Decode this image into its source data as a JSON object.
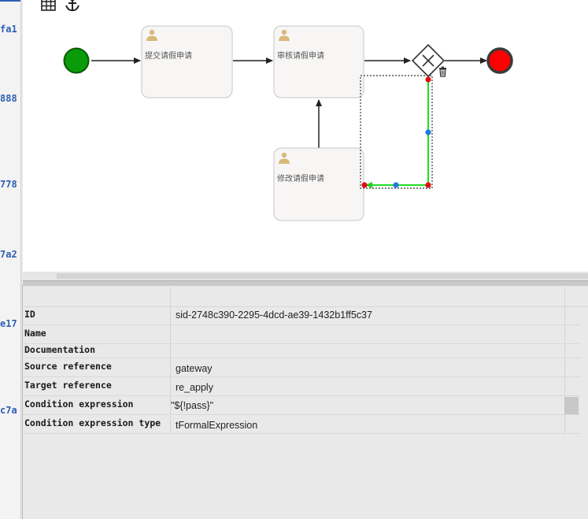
{
  "gutter": {
    "items": [
      "fa1",
      "888",
      "778",
      "7a2",
      "e17",
      "c7a"
    ]
  },
  "toolbar": {
    "icons": [
      "grid-icon",
      "anchor-icon"
    ]
  },
  "diagram": {
    "tasks": [
      {
        "id": "submit",
        "label": "提交请假申请"
      },
      {
        "id": "review",
        "label": "审核请假申请"
      },
      {
        "id": "modify",
        "label": "修改请假申请"
      }
    ],
    "start_event_color": "#0a9b0a",
    "end_event_color": "#ff0000",
    "selected_flow_color": "#22dd22"
  },
  "properties": {
    "rows": [
      {
        "key": "ID",
        "value": "sid-2748c390-2295-4dcd-ae39-1432b1ff5c37"
      },
      {
        "key": "Name",
        "value": ""
      },
      {
        "key": "Documentation",
        "value": ""
      },
      {
        "key": "Source reference",
        "value": "gateway"
      },
      {
        "key": "Target reference",
        "value": "re_apply"
      },
      {
        "key": "Condition expression",
        "value": "\"${!pass}\""
      },
      {
        "key": "Condition expression type",
        "value": "tFormalExpression"
      }
    ]
  }
}
